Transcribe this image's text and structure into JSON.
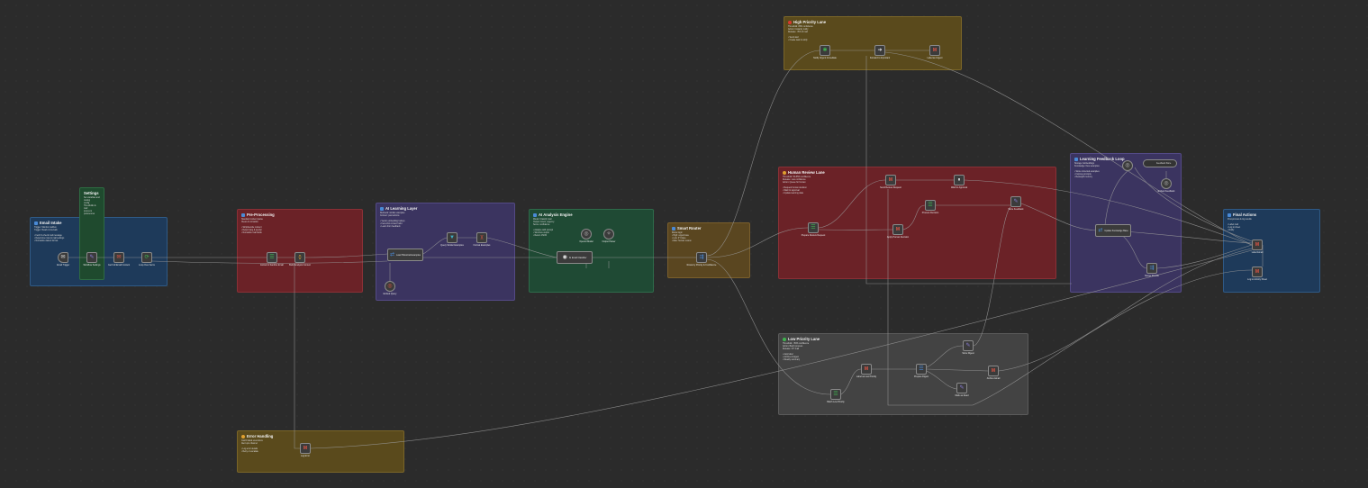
{
  "stickies": [
    {
      "key": "email_intake",
      "title": "Email Intake",
      "color": "#1e3a5a",
      "icon_color": "#4a8ad6",
      "body": "Trigger: Monitor mailbox\nTrigger: Read-in intervals\n\n• Fetch & check mail message\n• Determine rules & mail settings\n• Normalize data & format"
    },
    {
      "key": "settings",
      "title": "Settings",
      "color": "#1f4a2e",
      "icon_color": "",
      "body": "Set variables and routing\nconfig. Thresholds & mail\nscores & preferences"
    },
    {
      "key": "preprocessing",
      "title": "Pre-Processing",
      "color": "#6b2227",
      "icon_color": "#4a8ad6",
      "body": "Standard content parse\nClean & normalize\n\n• Strip/decode content\n• Detect lang & sender\n• Normalize mail fields"
    },
    {
      "key": "ai_learning",
      "title": "AI Learning Layer",
      "color": "#3b3460",
      "icon_color": "#4a8ad6",
      "body": "Retrieval: similar examples\nContext: past actions\n\n• Vector embedding lookup\n• Few-shot context build\n• Learn from feedback"
    },
    {
      "key": "ai_analysis",
      "title": "AI Analysis Engine",
      "color": "#1f4a34",
      "icon_color": "#4a8ad6",
      "body": "Model: Classify mail\nOutput: Intent, urgency\nScore: confidence\n\n• Analyze with prompt\n• Structure output\n• Return JSON"
    },
    {
      "key": "smart_router",
      "title": "Smart Router",
      "color": "#5a4620",
      "icon_color": "#4a8ad6",
      "body": "Route logic:\n• High: urgent lane\n• Low: FYI lane\n• Else: human review"
    },
    {
      "key": "high_priority",
      "title": "High Priority Lane",
      "color": "#5a4a1c",
      "icon_color": "#d9382f",
      "body": "Threshold: 85% confidence\nAction: Instantly notify\nRelease: <5% of mail\n\n• Send alert\n• Create task & notify"
    },
    {
      "key": "human_review",
      "title": "Human Review Lane",
      "color": "#6b2227",
      "icon_color": "#e0a030",
      "body": "Threshold: 50-85% confidence\nRelease: Low confidence\nAction: Queue for human\n\n• Request human decision\n• Wait for approval\n• Update learning data"
    },
    {
      "key": "learning_feedback",
      "title": "Learning Feedback Loop",
      "color": "#3b3460",
      "icon_color": "#4a8ad6",
      "body": "Storage: Embeddings\nKnowledge: New examples\n\n• Store corrected examples\n• Improve prompts\n• Reweight memory"
    },
    {
      "key": "final_actions",
      "title": "Final Actions",
      "color": "#1e3a5a",
      "icon_color": "#4a8ad6",
      "body": "Post-process & log results\n\n• Label mail\n• Log to sheet\n• Notify"
    },
    {
      "key": "low_priority",
      "title": "Low Priority Lane",
      "color": "#434343",
      "icon_color": "#3fb34f",
      "body": "Threshold: <50% confidence\nAction: Batch process\nRelease: FYI mail\n\n• Auto label\n• Archive & digest\n• Weekly summary"
    },
    {
      "key": "error_handling",
      "title": "Error Handling",
      "color": "#5a4a1c",
      "icon_color": "#e0a030",
      "body": "Catch failed executions\nAlert ops channel\n\n• Log error details\n• Retry or escalate"
    }
  ],
  "nodes": [
    {
      "key": "gmail_trigger",
      "label": "Gmail Trigger",
      "sub": "",
      "icon": "✉",
      "color": "#d9d9d9"
    },
    {
      "key": "workflow_settings",
      "label": "Workflow Settings",
      "sub": "Set config",
      "icon": "✎",
      "color": "#8a7dd8"
    },
    {
      "key": "get_full_email",
      "label": "Get Full Email Content",
      "sub": "",
      "icon": "✉",
      "color": "#e25545"
    },
    {
      "key": "loop_emails",
      "label": "Loop Over Items",
      "sub": "",
      "icon": "⟳",
      "color": "#3fb34f"
    },
    {
      "key": "extract_email",
      "label": "Extract & Sanitize Email",
      "sub": "Code: normalize",
      "icon": "☰",
      "color": "#3fb34f"
    },
    {
      "key": "build_context",
      "label": "Build Analysis Context",
      "sub": "",
      "icon": "{}",
      "color": "#e0a030"
    },
    {
      "key": "load_examples",
      "label": "Load Historical Examples",
      "sub": "",
      "icon": "⇄",
      "color": "#4a8ad6"
    },
    {
      "key": "vector_store",
      "label": "Query Similar Examples",
      "sub": "Vector store",
      "icon": "▼",
      "color": "#3fb0c8"
    },
    {
      "key": "format_examples",
      "label": "Format Examples",
      "sub": "",
      "icon": "}{",
      "color": "#e25545"
    },
    {
      "key": "openai_embed",
      "label": "Embed Query",
      "sub": "",
      "icon": "◎",
      "color": "#e25545"
    },
    {
      "key": "ai_classifier",
      "label": "AI Email Classifier",
      "sub": "",
      "icon": "◉",
      "color": "#e6e6e6"
    },
    {
      "key": "openai_model",
      "label": "OpenAI Model",
      "sub": "",
      "icon": "◎",
      "color": "#bbb"
    },
    {
      "key": "json_parser",
      "label": "Output Parser",
      "sub": "",
      "icon": "✧",
      "color": "#bbb"
    },
    {
      "key": "route_by_priority",
      "label": "Route by Priority & Confidence",
      "sub": "",
      "icon": "⇶",
      "color": "#4a8ad6"
    },
    {
      "key": "notify_urgent",
      "label": "Notify Urgent Immediate",
      "sub": "Slack",
      "icon": "✱",
      "color": "#3fb34f"
    },
    {
      "key": "forward_email",
      "label": "Forward to Important",
      "sub": "",
      "icon": "➜",
      "color": "#e6e6e6"
    },
    {
      "key": "label_urgent",
      "label": "Label as Urgent",
      "sub": "",
      "icon": "M",
      "color": "#e25545"
    },
    {
      "key": "review_queue",
      "label": "Prepare Review Request",
      "sub": "",
      "icon": "☰",
      "color": "#3fb34f"
    },
    {
      "key": "send_review",
      "label": "Send Review Request",
      "sub": "",
      "icon": "M",
      "color": "#e25545"
    },
    {
      "key": "wait_approval",
      "label": "Wait for Approval",
      "sub": "",
      "icon": "⏸",
      "color": "#e6e6e6"
    },
    {
      "key": "process_decision",
      "label": "Process Decision",
      "sub": "",
      "icon": "☰",
      "color": "#3fb34f"
    },
    {
      "key": "apply_review",
      "label": "Apply Human Decision",
      "sub": "",
      "icon": "M",
      "color": "#e25545"
    },
    {
      "key": "store_feedback",
      "label": "Store Feedback",
      "sub": "",
      "icon": "✎",
      "color": "#8a7dd8"
    },
    {
      "key": "update_vector",
      "label": "Update Knowledge Base",
      "sub": "",
      "icon": "⇄",
      "color": "#4a8ad6"
    },
    {
      "key": "embed_feedback",
      "label": "Embed Feedback",
      "sub": "",
      "icon": "◎",
      "color": "#bbb"
    },
    {
      "key": "merge_results",
      "label": "Merge Results",
      "sub": "",
      "icon": "⇶",
      "color": "#4a8ad6"
    },
    {
      "key": "label_final",
      "label": "Label Email",
      "sub": "",
      "icon": "M",
      "color": "#e25545"
    },
    {
      "key": "notify_final",
      "label": "Log to Activity Sheet",
      "sub": "",
      "icon": "M",
      "color": "#e25545"
    },
    {
      "key": "batch_low",
      "label": "Batch Low Priority",
      "sub": "",
      "icon": "☰",
      "color": "#3fb34f"
    },
    {
      "key": "label_low",
      "label": "Label as Low Priority",
      "sub": "",
      "icon": "M",
      "color": "#e25545"
    },
    {
      "key": "digest_summary",
      "label": "Prepare Digest",
      "sub": "",
      "icon": "☰",
      "color": "#4a8ad6"
    },
    {
      "key": "save_digest",
      "label": "Store Digest",
      "sub": "",
      "icon": "✎",
      "color": "#8a7dd8"
    },
    {
      "key": "archive_low",
      "label": "Archive Email",
      "sub": "",
      "icon": "M",
      "color": "#e25545"
    },
    {
      "key": "mark_read",
      "label": "Mark as Read",
      "sub": "",
      "icon": "✎",
      "color": "#8a7dd8"
    },
    {
      "key": "error_alert",
      "label": "Log Error",
      "sub": "",
      "icon": "M",
      "color": "#e25545"
    }
  ],
  "pill_label": "Feedback Store"
}
